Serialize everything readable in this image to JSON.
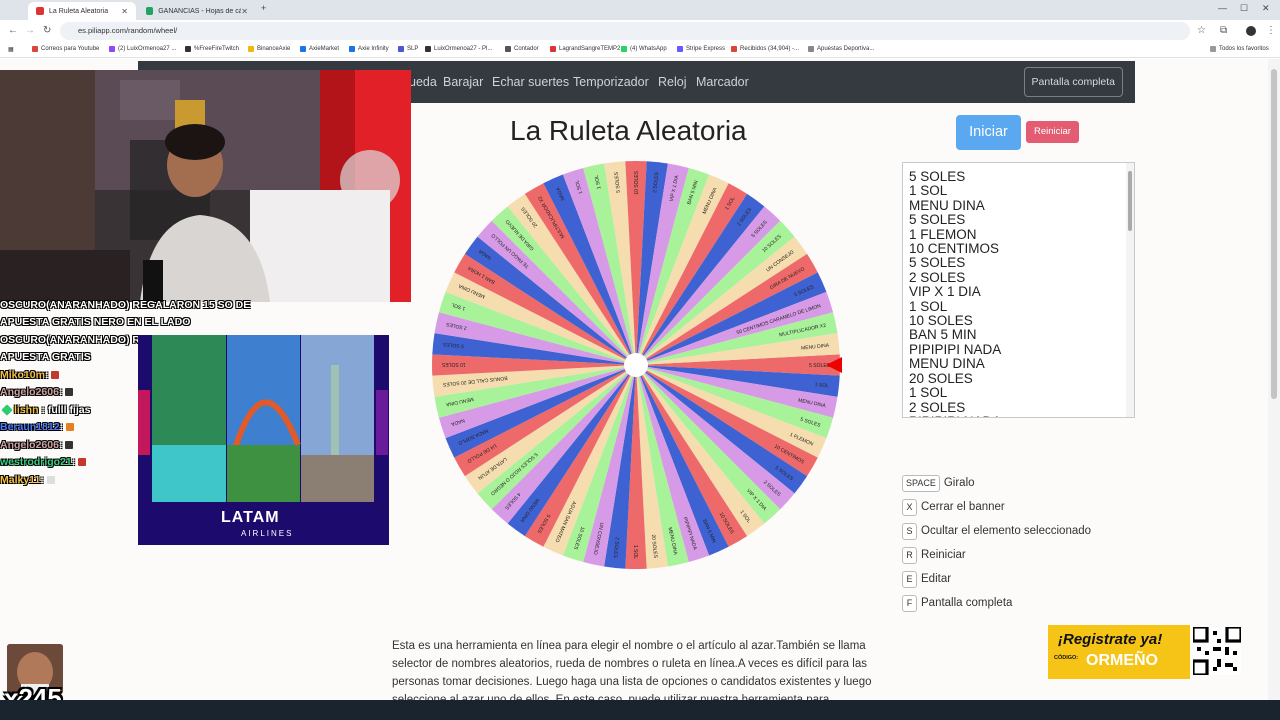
{
  "browser": {
    "tabs": [
      {
        "title": "La Ruleta Aleatoria",
        "active": true,
        "color": "#d33"
      },
      {
        "title": "GANANCIAS - Hojas de cálculo",
        "active": false,
        "color": "#1ea362"
      }
    ],
    "new_tab": "+",
    "window_controls": [
      "—",
      "☐",
      "✕"
    ],
    "url": "es.piliapp.com/random/wheel/",
    "bookmarks": [
      {
        "label": "Correos para Youtube",
        "color": "#db4437"
      },
      {
        "label": "(2) LuixOrmenoa27 ...",
        "color": "#9146ff"
      },
      {
        "label": "%FreeFireTwitch",
        "color": "#333"
      },
      {
        "label": "BinanceAxie",
        "color": "#f0b90b"
      },
      {
        "label": "AxieMarket",
        "color": "#1a73e8"
      },
      {
        "label": "Axie Infinity",
        "color": "#1a73e8"
      },
      {
        "label": "SLP",
        "color": "#4b56d8"
      },
      {
        "label": "LuixOrmenoa27 - Pl...",
        "color": "#333"
      },
      {
        "label": "Contador",
        "color": "#555"
      },
      {
        "label": "LagrandSangreTEMP2",
        "color": "#d33"
      },
      {
        "label": "(4) WhatsApp",
        "color": "#25d366"
      },
      {
        "label": "Stripe Express",
        "color": "#635bff"
      },
      {
        "label": "Recibidos (34,904) -...",
        "color": "#db4437"
      },
      {
        "label": "Apuestas Deportiva...",
        "color": "#888"
      }
    ],
    "all_bookmarks": "Todos los favoritos"
  },
  "nav": {
    "links": [
      "Rueda",
      "Barajar",
      "Echar suertes",
      "Temporizador",
      "Reloj",
      "Marcador"
    ],
    "fullscreen_label": "Pantalla completa"
  },
  "main": {
    "title": "La Ruleta Aleatoria",
    "start_label": "Iniciar",
    "reset_label": "Reiniciar"
  },
  "wheel": {
    "colors": [
      "#ee6a6a",
      "#3f62d3",
      "#d79ae6",
      "#a8f29a",
      "#f5ddb0"
    ],
    "segment_count": 60,
    "labels": [
      "5 SOLES",
      "1 SOL",
      "MENU DINA",
      "5 SOLES",
      "1 FLEMON",
      "10 CENTIMOS",
      "5 SOLES",
      "2 SOLES",
      "VIP X 1 DIA",
      "1 SOL",
      "10 SOLES",
      "BAN 5 MIN",
      "PIPIPIPI NADA",
      "MENU DINA",
      "20 SOLES",
      "1 SOL",
      "2 SOLES",
      "UN CONSEJO",
      "10 SOLES",
      "AGUA SAN MATEO",
      "5 SOLES",
      "MENU DINA",
      "4 SOLES",
      "5 SOLES ROJO O NEGRO",
      "LATA DE ATUN",
      "1/4 DE POLLO",
      "NADA SOPLO",
      "NADA",
      "MENU DINA",
      "BONUS CALL DE 20 SOLES",
      "10 SOLES",
      "5 SOLES",
      "2 SOLES",
      "1 SOL",
      "MENU DINA",
      "BAN 1 HORA",
      "NADA",
      "TE PAGO UN POLLO",
      "GIRA DE NUEVO",
      "20 SOLES",
      "MULTIPLICADOR X2",
      "NADA",
      "1 SOL",
      "1 SOL",
      "5 SOLES",
      "10 SOLES",
      "2 SOLES",
      "VIP X 1 DIA",
      "BAN 5 MIN",
      "MENU DINA",
      "1 SOL",
      "2 SOLES",
      "5 SOLES",
      "10 SOLES",
      "UN CONSEJO",
      "GIRA DE NUEVO",
      "5 SOLES",
      "50 CENTIMOS CARAMELO DE LIMON",
      "MULTIPLICADOR X2",
      "MENU DINA"
    ]
  },
  "options": [
    "5 SOLES",
    "1 SOL",
    "MENU DINA",
    "5 SOLES",
    "1 FLEMON",
    "10 CENTIMOS",
    "5 SOLES",
    "2 SOLES",
    "VIP X 1 DIA",
    "1 SOL",
    "10 SOLES",
    "BAN 5 MIN",
    "PIPIPIPI NADA",
    "MENU DINA",
    "20 SOLES",
    "1 SOL",
    "2 SOLES",
    "PIPIPIPI NADA"
  ],
  "shortcuts": [
    {
      "key": "SPACE",
      "label": "Giralo"
    },
    {
      "key": "X",
      "label": "Cerrar el banner"
    },
    {
      "key": "S",
      "label": "Ocultar el elemento seleccionado"
    },
    {
      "key": "R",
      "label": "Reiniciar"
    },
    {
      "key": "E",
      "label": "Editar"
    },
    {
      "key": "F",
      "label": "Pantalla completa"
    }
  ],
  "description": "Esta es una herramienta en línea para elegir el nombre o el artículo al azar.También se llama selector de nombres aleatorios, rueda de nombres o ruleta en línea.A veces es difícil para las personas tomar decisiones. Luego haga una lista de opciones o candidatos existentes y luego seleccione al azar uno de ellos. En este caso, puede utilizar nuestra herramienta para",
  "promo": {
    "headline": "¡Registrate ya!",
    "code_label": "CÓDIGO:",
    "code": "ORMEÑO"
  },
  "chat": {
    "system_lines": [
      "OSCURO(ANARANHADO) REGALARON 15 SO DE",
      "APUESTA GRATIS NERO EN EL LADO",
      "OSCURO(ANARANHADO) REGALARON 15 SO DE",
      "APUESTA GRATIS"
    ],
    "messages": [
      {
        "user": "Miko10m",
        "color": "#f5c242",
        "text": ""
      },
      {
        "user": "Angelo2606",
        "color": "#d0a0a0",
        "text": ""
      },
      {
        "user": "lishn",
        "color": "#f5c242",
        "text": "fulll fijas"
      },
      {
        "user": "Beraun1812",
        "color": "#4a7bff",
        "text": ""
      },
      {
        "user": "Angelo2606",
        "color": "#d0a0a0",
        "text": ""
      },
      {
        "user": "westrodrigo21",
        "color": "#35d07f",
        "text": ""
      },
      {
        "user": "Malky11",
        "color": "#f5c242",
        "text": ""
      }
    ]
  },
  "ad": {
    "brand": "LATAM",
    "sub": "AIRLINES"
  },
  "overlay_counter": "x245"
}
